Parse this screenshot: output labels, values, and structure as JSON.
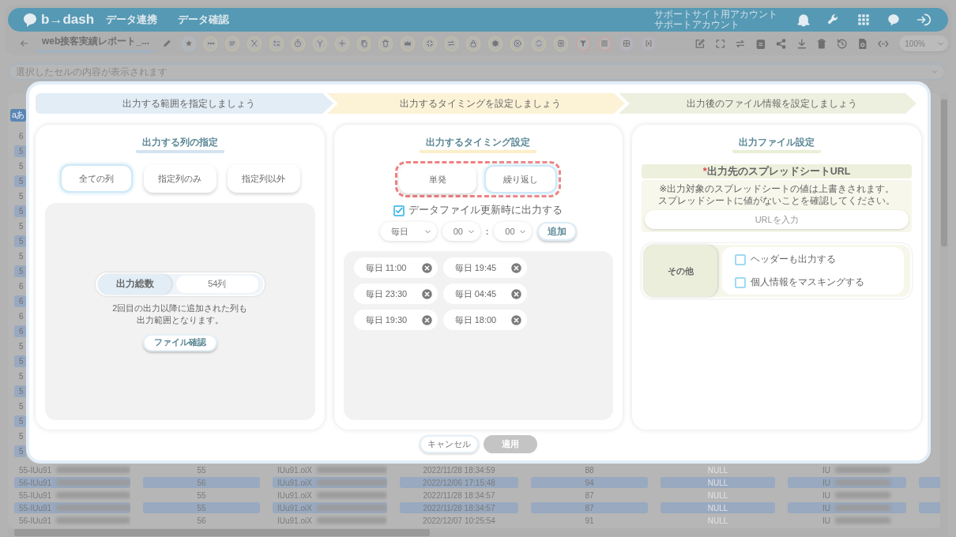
{
  "header": {
    "logo": "b→dash",
    "nav": [
      "データ連携",
      "データ確認"
    ],
    "account": [
      "サポートサイト用アカウント",
      "サポートアカウント"
    ]
  },
  "toolbar": {
    "report_title": "web接客実績レポート_...",
    "zoom": "100%"
  },
  "cell_bar": {
    "placeholder": "選択したセルの内容が表示されます"
  },
  "table": {
    "corner": "aあ",
    "stub_rows": [
      {
        "text": "6",
        "shaded": false
      },
      {
        "text": "5",
        "shaded": true
      },
      {
        "text": "5",
        "shaded": false
      },
      {
        "text": "5",
        "shaded": true
      },
      {
        "text": "5",
        "shaded": false
      },
      {
        "text": "5",
        "shaded": true
      },
      {
        "text": "5",
        "shaded": false
      },
      {
        "text": "5",
        "shaded": true
      },
      {
        "text": "5",
        "shaded": false
      },
      {
        "text": "5",
        "shaded": true
      },
      {
        "text": "6",
        "shaded": false
      },
      {
        "text": "6",
        "shaded": true
      },
      {
        "text": "6",
        "shaded": false
      },
      {
        "text": "6",
        "shaded": true
      },
      {
        "text": "5",
        "shaded": false
      },
      {
        "text": "5",
        "shaded": true
      },
      {
        "text": "5",
        "shaded": false
      },
      {
        "text": "5",
        "shaded": true
      },
      {
        "text": "5",
        "shaded": false
      },
      {
        "text": "5",
        "shaded": true
      },
      {
        "text": "5",
        "shaded": false
      },
      {
        "text": "5",
        "shaded": true
      }
    ],
    "rows": [
      {
        "shaded": false,
        "cells": [
          "55-IUu91",
          "55",
          "IUu91.oiX",
          "2022/11/28 18:34:59",
          "88",
          "NULL",
          "IU"
        ]
      },
      {
        "shaded": true,
        "cells": [
          "56-IUu91",
          "56",
          "IUu91.oiX",
          "2022/12/06 17:15:48",
          "94",
          "NULL",
          "IU"
        ]
      },
      {
        "shaded": false,
        "cells": [
          "55-IUu91",
          "55",
          "IUu91.oiX",
          "2022/11/28 18:34:57",
          "87",
          "NULL",
          "IU"
        ]
      },
      {
        "shaded": true,
        "cells": [
          "55-IUu91",
          "55",
          "IUu91.oiX",
          "2022/11/28 18:34:57",
          "87",
          "NULL",
          "IU"
        ]
      },
      {
        "shaded": false,
        "cells": [
          "56-IUu91",
          "56",
          "IUu91.oiX",
          "2022/12/07 10:25:54",
          "91",
          "NULL",
          "IU"
        ]
      }
    ]
  },
  "modal": {
    "steps": [
      {
        "label": "出力する範囲を指定しましょう",
        "color": "#e2edf6"
      },
      {
        "label": "出力するタイミングを設定しましょう",
        "color": "#fcf2d6"
      },
      {
        "label": "出力後のファイル情報を設定しましょう",
        "color": "#edf0df"
      }
    ],
    "columns_panel": {
      "title": "出力する列の指定",
      "modes": [
        {
          "label": "全ての列",
          "selected": true
        },
        {
          "label": "指定列のみ",
          "selected": false
        },
        {
          "label": "指定列以外",
          "selected": false
        }
      ],
      "total": {
        "label": "出力総数",
        "value": "54列"
      },
      "note": [
        "2回目の出力以降に追加された列も",
        "出力範囲となります。"
      ],
      "check_button": "ファイル確認"
    },
    "timing_panel": {
      "title": "出力するタイミング設定",
      "modes": [
        {
          "label": "単発",
          "selected": false
        },
        {
          "label": "繰り返し",
          "selected": true
        }
      ],
      "on_update": {
        "label": "データファイル更新時に出力する",
        "checked": true
      },
      "schedule": {
        "frequency": "毎日",
        "hour": "00",
        "separator": ":",
        "minute": "00",
        "add": "追加"
      },
      "times": [
        "毎日 11:00",
        "毎日 19:45",
        "毎日 23:30",
        "毎日 04:45",
        "毎日 19:30",
        "毎日 18:00"
      ]
    },
    "file_panel": {
      "title": "出力ファイル設定",
      "url": {
        "required_mark": "*",
        "label": "出力先のスプレッドシートURL",
        "note": [
          "※出力対象のスプレッドシートの値は上書きされます。",
          "スプレッドシートに値がないことを確認してください。"
        ],
        "placeholder": "URLを入力"
      },
      "other": {
        "label": "その他",
        "options": [
          {
            "label": "ヘッダーも出力する",
            "checked": false
          },
          {
            "label": "個人情報をマスキングする",
            "checked": false
          }
        ]
      }
    },
    "footer": {
      "cancel": "キャンセル",
      "apply": {
        "label": "適用",
        "disabled": true
      }
    }
  }
}
